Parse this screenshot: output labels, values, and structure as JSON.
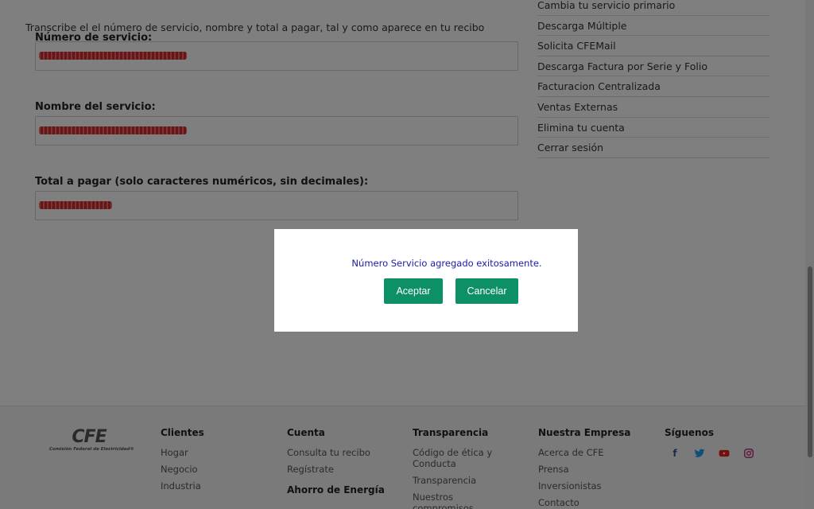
{
  "form": {
    "intro": "Transcribe el el número de servicio, nombre y total a pagar, tal y como aparece en tu recibo",
    "service_number_label": "Número de servicio:",
    "service_name_label": "Nombre del servicio:",
    "total_label": "Total a pagar (solo caracteres numéricos, sin decimales):"
  },
  "menu": {
    "items": [
      "Cambia tu servicio primario",
      "Descarga Múltiple",
      "Solicita CFEMail",
      "Descarga Factura por Serie y Folio",
      "Facturacion Centralizada",
      "Ventas Externas",
      "Elimina tu cuenta",
      "Cerrar sesión"
    ]
  },
  "footer": {
    "logo_text": "CFE",
    "logo_subtext": "Comisión Federal de Electricidad®",
    "clientes": {
      "title": "Clientes",
      "links": [
        "Hogar",
        "Negocio",
        "Industria"
      ]
    },
    "cuenta": {
      "title": "Cuenta",
      "links": [
        "Consulta tu recibo",
        "Regístrate"
      ],
      "title2": "Ahorro de Energía"
    },
    "transparencia": {
      "title": "Transparencia",
      "links": [
        "Código de ética y Conducta",
        "Transparencia",
        "Nuestros compromisos contigo"
      ]
    },
    "empresa": {
      "title": "Nuestra Empresa",
      "links": [
        "Acerca de CFE",
        "Prensa",
        "Inversionistas",
        "Contacto"
      ]
    },
    "siguenos": {
      "title": "Síguenos",
      "icons": [
        "facebook-icon",
        "twitter-icon",
        "youtube-icon",
        "instagram-icon"
      ]
    }
  },
  "modal": {
    "message": "Número Servicio agregado exitosamente.",
    "accept_label": "Aceptar",
    "cancel_label": "Cancelar"
  },
  "colors": {
    "button": "#0d9068",
    "message": "#1a1aa8",
    "facebook": "#3b5998",
    "twitter": "#1da1f2",
    "youtube": "#e62117",
    "instagram": "#c13584"
  }
}
